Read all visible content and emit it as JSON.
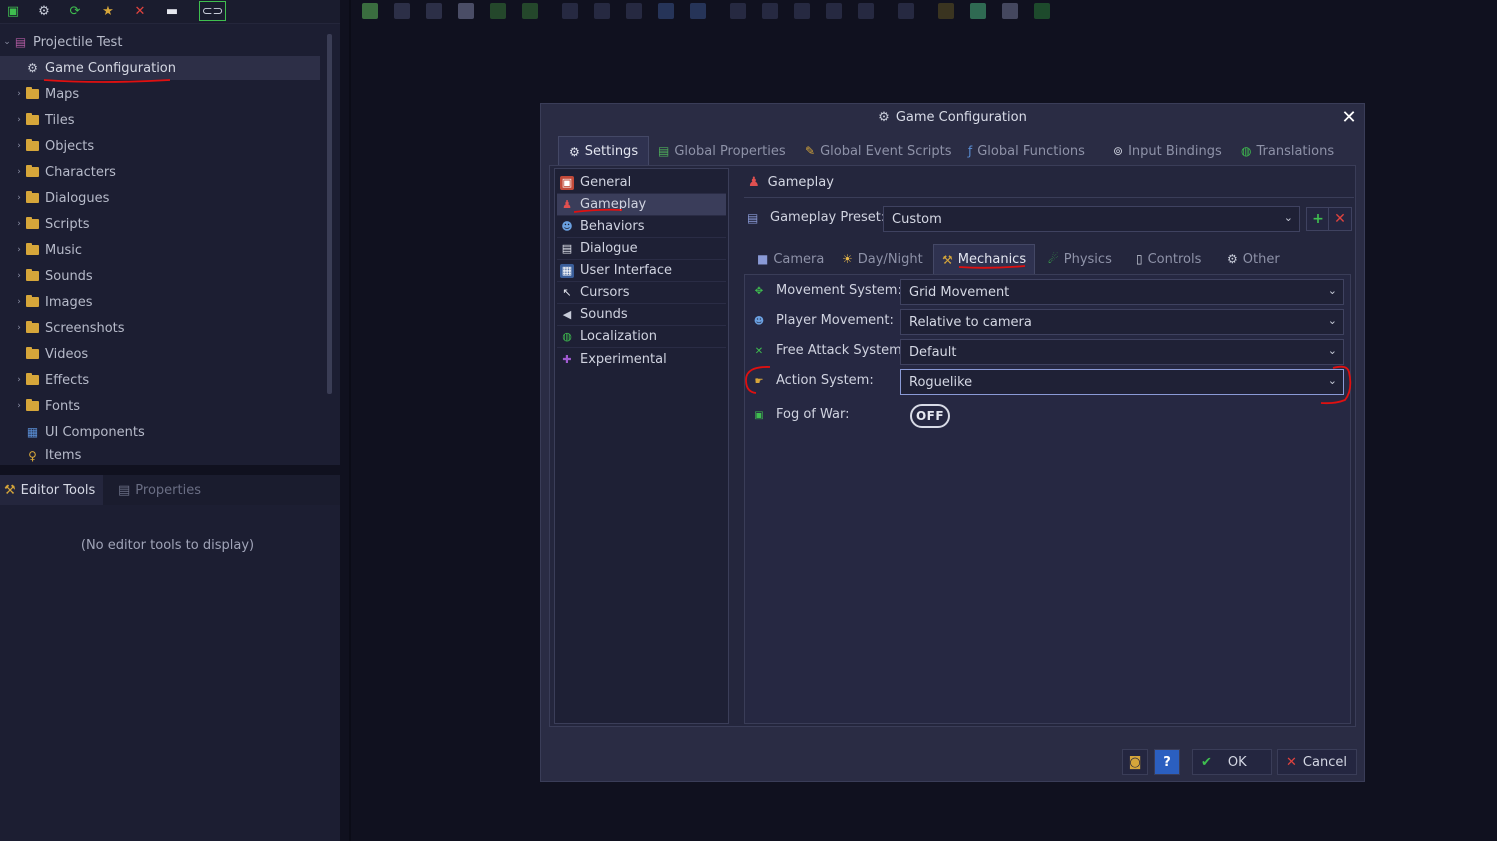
{
  "tree": {
    "root": "Projectile Test",
    "items": [
      {
        "label": "Game Configuration",
        "icon": "gear-icon"
      },
      {
        "label": "Maps",
        "icon": "folder-icon"
      },
      {
        "label": "Tiles",
        "icon": "folder-icon"
      },
      {
        "label": "Objects",
        "icon": "folder-icon"
      },
      {
        "label": "Characters",
        "icon": "folder-icon"
      },
      {
        "label": "Dialogues",
        "icon": "folder-icon"
      },
      {
        "label": "Scripts",
        "icon": "folder-icon"
      },
      {
        "label": "Music",
        "icon": "folder-icon"
      },
      {
        "label": "Sounds",
        "icon": "folder-icon"
      },
      {
        "label": "Images",
        "icon": "folder-icon"
      },
      {
        "label": "Screenshots",
        "icon": "folder-icon"
      },
      {
        "label": "Videos",
        "icon": "folder-icon"
      },
      {
        "label": "Effects",
        "icon": "folder-icon"
      },
      {
        "label": "Fonts",
        "icon": "folder-icon"
      },
      {
        "label": "UI Components",
        "icon": "ui-components-icon"
      },
      {
        "label": "Items",
        "icon": "items-icon"
      }
    ]
  },
  "left_tabs": {
    "editor_tools": "Editor Tools",
    "properties": "Properties",
    "empty_message": "(No editor tools to display)"
  },
  "dialog": {
    "title": "Game Configuration",
    "close_glyph": "✕",
    "tabs": [
      "Settings",
      "Global Properties",
      "Global Event Scripts",
      "Global Functions",
      "Input Bindings",
      "Translations"
    ],
    "categories": [
      "General",
      "Gameplay",
      "Behaviors",
      "Dialogue",
      "User Interface",
      "Cursors",
      "Sounds",
      "Localization",
      "Experimental"
    ],
    "section_title": "Gameplay",
    "preset_label": "Gameplay Preset:",
    "preset_value": "Custom",
    "subtabs": [
      "Camera",
      "Day/Night",
      "Mechanics",
      "Physics",
      "Controls",
      "Other"
    ],
    "fields": [
      {
        "label": "Movement System:",
        "value": "Grid Movement"
      },
      {
        "label": "Player Movement:",
        "value": "Relative to camera"
      },
      {
        "label": "Free Attack System:",
        "value": "Default"
      },
      {
        "label": "Action System:",
        "value": "Roguelike"
      }
    ],
    "fog_label": "Fog of War:",
    "fog_state": "OFF",
    "ok_label": "OK",
    "cancel_label": "Cancel"
  },
  "colors": {
    "accent_green": "#3fbf4f",
    "danger_red": "#e0433e",
    "annotation_red": "#e01010"
  }
}
